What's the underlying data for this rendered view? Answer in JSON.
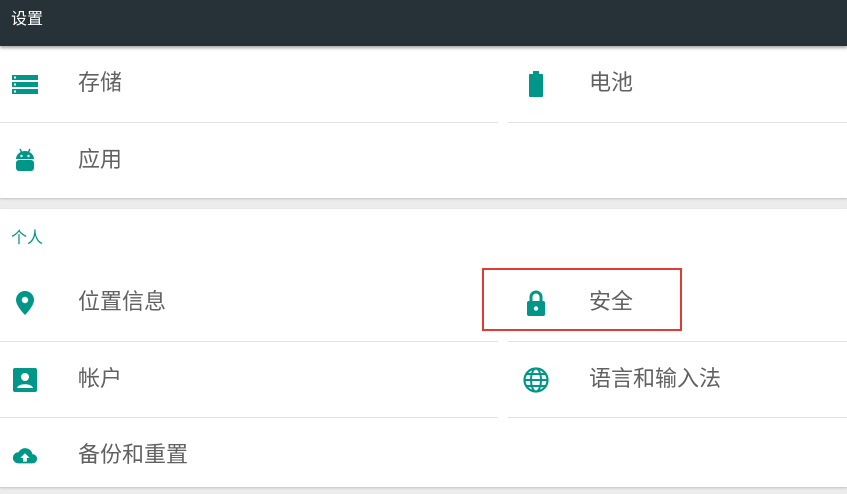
{
  "header": {
    "title": "设置"
  },
  "device": {
    "items": [
      {
        "label": "存储",
        "icon": "storage-icon"
      },
      {
        "label": "电池",
        "icon": "battery-icon"
      },
      {
        "label": "应用",
        "icon": "android-icon"
      }
    ]
  },
  "personal": {
    "header": "个人",
    "items": [
      {
        "label": "位置信息",
        "icon": "location-icon"
      },
      {
        "label": "安全",
        "icon": "lock-icon"
      },
      {
        "label": "帐户",
        "icon": "account-icon"
      },
      {
        "label": "语言和输入法",
        "icon": "globe-icon"
      },
      {
        "label": "备份和重置",
        "icon": "cloud-upload-icon"
      }
    ]
  },
  "colors": {
    "accent": "#009688",
    "titlebar": "#263238",
    "highlight": "#e53935"
  }
}
